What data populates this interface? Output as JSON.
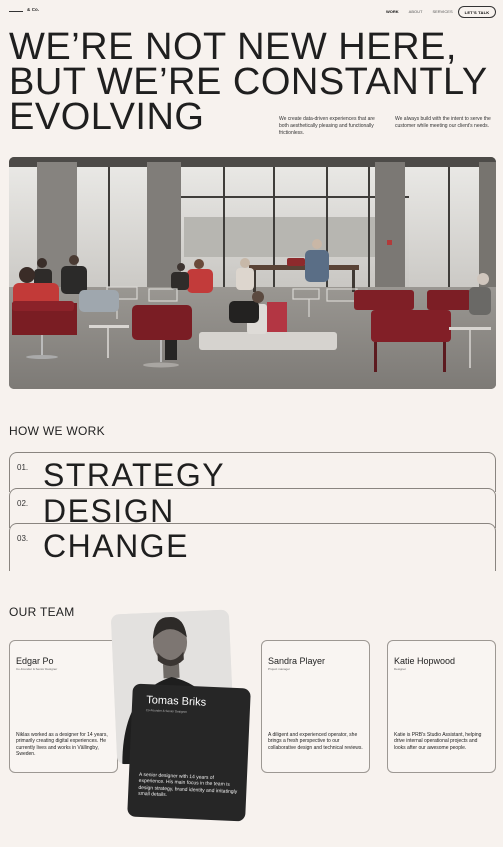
{
  "nav": {
    "logo": "& Co.",
    "links": [
      "WORK",
      "ABOUT",
      "SERVICES"
    ],
    "cta": "LET'S TALK"
  },
  "hero": {
    "title_lines": [
      "WE’RE NOT NEW HERE,",
      "BUT WE’RE CONSTANTLY",
      "EVOLVING"
    ],
    "paragraph_1": "We create data-driven experiences that are both aesthetically pleasing and functionally frictionless.",
    "paragraph_2": "We always build with the intent to serve the customer while meeting our client's needs."
  },
  "how_we_work": {
    "title": "HOW WE WORK",
    "items": [
      {
        "number": "01.",
        "label": "STRATEGY"
      },
      {
        "number": "02.",
        "label": "DESIGN"
      },
      {
        "number": "03.",
        "label": "CHANGE"
      }
    ]
  },
  "team": {
    "title": "OUR TEAM",
    "members": [
      {
        "name": "Edgar Po",
        "role": "Co-Founder & Senior Designer",
        "description": "Niklas worked as a designer for 14 years, primarily creating digital experiences. He currently lives and works in Vällingby, Sweden."
      },
      {
        "name": "Tomas Briks",
        "role": "Co-Founder & Senior Designer",
        "description": "A senior designer with 14 years of experience. His main focus in the team is design strategy, brand identity and irritatingly small details."
      },
      {
        "name": "Sandra Player",
        "role": "Project manager",
        "description": "A diligent and experienced operator, she brings a fresh perspective to our collaborative design and technical reviews."
      },
      {
        "name": "Katie Hopwood",
        "role": "Designer",
        "description": "Katie is PRB's Studio Assistant, helping drive internal operational projects and looks after our awesome people."
      }
    ]
  }
}
